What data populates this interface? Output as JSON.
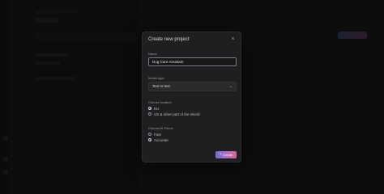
{
  "modal": {
    "title": "Create new project",
    "close_icon": "close-icon",
    "name": {
      "label": "Name",
      "value": "Dog Care Assistant"
    },
    "model_type": {
      "label": "Model type",
      "selected": "Text to text",
      "icon": "chevron-down-icon"
    },
    "location": {
      "label": "Choose location",
      "options": [
        {
          "label": "EU",
          "selected": true
        },
        {
          "label": "US & other part of the World",
          "selected": false
        }
      ]
    },
    "ai_focus": {
      "label": "Choose AI Focus",
      "options": [
        {
          "label": "Fast",
          "selected": false
        },
        {
          "label": "Accurate",
          "selected": true
        }
      ]
    },
    "create_button": {
      "label": "Create",
      "icon": "plus-icon"
    }
  },
  "colors": {
    "background": "#161617",
    "modal_bg": "#1f1f21",
    "accent_gradient": [
      "#6a73d6",
      "#b26ac8",
      "#d46a8e"
    ]
  }
}
